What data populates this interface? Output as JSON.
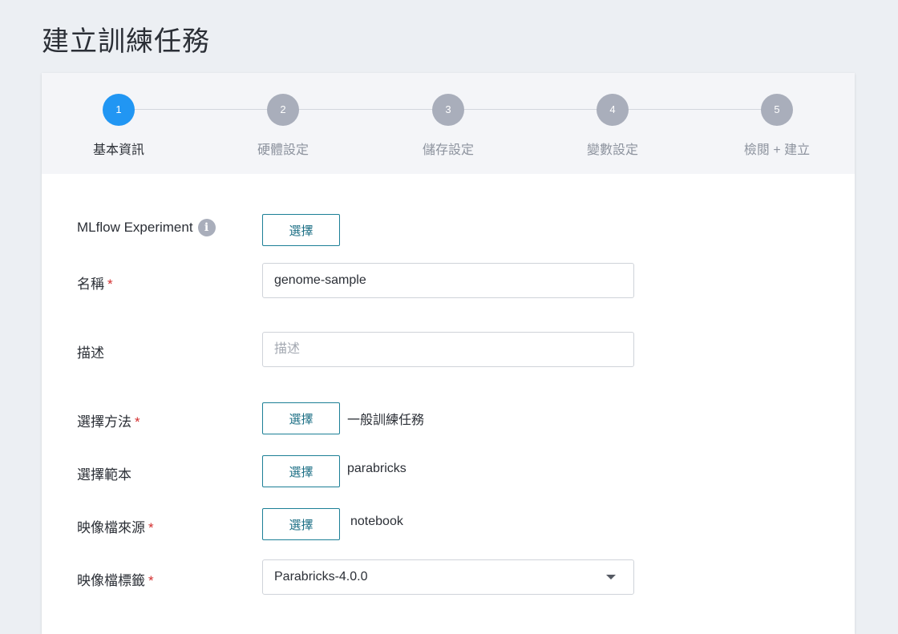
{
  "page": {
    "title": "建立訓練任務"
  },
  "stepper": {
    "steps": [
      {
        "number": "1",
        "label": "基本資訊",
        "active": true
      },
      {
        "number": "2",
        "label": "硬體設定",
        "active": false
      },
      {
        "number": "3",
        "label": "儲存設定",
        "active": false
      },
      {
        "number": "4",
        "label": "變數設定",
        "active": false
      },
      {
        "number": "5",
        "label": "檢閱 + 建立",
        "active": false
      }
    ]
  },
  "form": {
    "mlflow": {
      "label": "MLflow Experiment",
      "info_icon": "i",
      "button": "選擇"
    },
    "name": {
      "label": "名稱",
      "required_mark": "*",
      "value": "genome-sample"
    },
    "description": {
      "label": "描述",
      "placeholder": "描述",
      "value": ""
    },
    "method": {
      "label": "選擇方法",
      "required_mark": "*",
      "button": "選擇",
      "value": "一般訓練任務"
    },
    "template": {
      "label": "選擇範本",
      "button": "選擇",
      "value": "parabricks"
    },
    "image_source": {
      "label": "映像檔來源",
      "required_mark": "*",
      "button": "選擇",
      "value": "notebook"
    },
    "image_tag": {
      "label": "映像檔標籤",
      "required_mark": "*",
      "value": "Parabricks-4.0.0"
    }
  },
  "icons": {
    "info": "info-icon",
    "dropdown": "chevron-down-icon"
  },
  "colors": {
    "accent": "#2196f3",
    "button_border": "#1c7f96",
    "required": "#d32f2f",
    "inactive_step": "#a9aebb"
  }
}
